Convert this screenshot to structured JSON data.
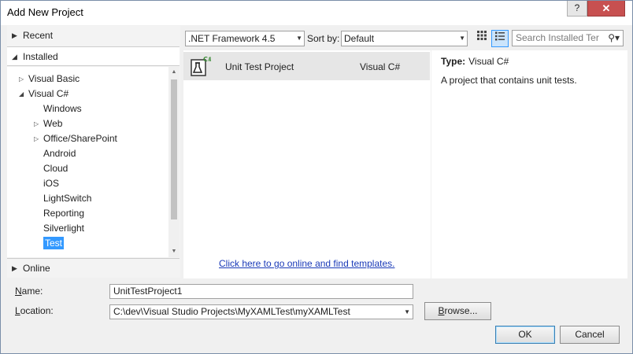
{
  "window": {
    "title": "Add New Project",
    "help_label": "?",
    "close_label": "✕"
  },
  "left_panel": {
    "recent_label": "Recent",
    "installed_label": "Installed",
    "online_label": "Online",
    "tree": [
      {
        "label": "Visual Basic",
        "depth": 1,
        "expander": "collapsed"
      },
      {
        "label": "Visual C#",
        "depth": 1,
        "expander": "expanded"
      },
      {
        "label": "Windows",
        "depth": 2,
        "expander": "none"
      },
      {
        "label": "Web",
        "depth": 2,
        "expander": "collapsed"
      },
      {
        "label": "Office/SharePoint",
        "depth": 2,
        "expander": "collapsed"
      },
      {
        "label": "Android",
        "depth": 2,
        "expander": "none"
      },
      {
        "label": "Cloud",
        "depth": 2,
        "expander": "none"
      },
      {
        "label": "iOS",
        "depth": 2,
        "expander": "none"
      },
      {
        "label": "LightSwitch",
        "depth": 2,
        "expander": "none"
      },
      {
        "label": "Reporting",
        "depth": 2,
        "expander": "none"
      },
      {
        "label": "Silverlight",
        "depth": 2,
        "expander": "none"
      },
      {
        "label": "Test",
        "depth": 2,
        "expander": "none",
        "selected": true
      }
    ]
  },
  "toolbar": {
    "framework": ".NET Framework 4.5",
    "sort_label": "Sort by:",
    "sort_value": "Default",
    "search_placeholder": "Search Installed Ter",
    "search_icon": "search-icon"
  },
  "templates": [
    {
      "name": "Unit Test Project",
      "language": "Visual C#",
      "icon_badge": "C#"
    }
  ],
  "online_link": "Click here to go online and find templates.",
  "details": {
    "type_label": "Type:",
    "type_value": "Visual C#",
    "description": "A project that contains unit tests."
  },
  "form": {
    "name_label": "Name:",
    "name_value": "UnitTestProject1",
    "location_label": "Location:",
    "location_value": "C:\\dev\\Visual Studio Projects\\MyXAMLTest\\myXAMLTest",
    "browse_label": "Browse...",
    "ok_label": "OK",
    "cancel_label": "Cancel"
  },
  "colors": {
    "selection": "#3399ff",
    "link": "#1a3ab8",
    "close": "#c75050"
  }
}
